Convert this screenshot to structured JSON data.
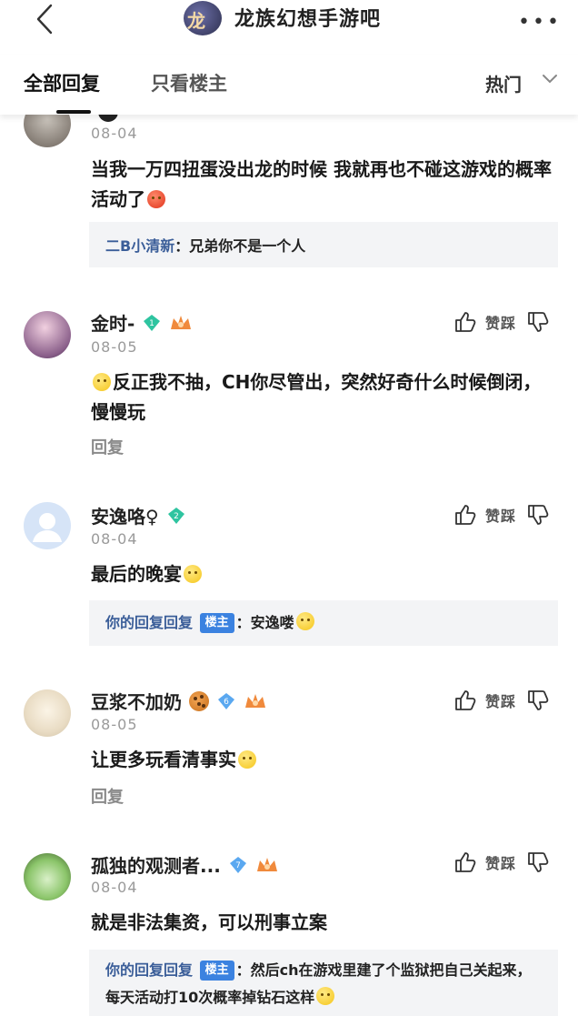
{
  "header": {
    "forum_title": "龙族幻想手游吧",
    "forum_avatar_text": "龙族",
    "back_icon": "chevron-left-icon",
    "more_icon": "more-dots-icon"
  },
  "tabs": {
    "all_replies": "全部回复",
    "host_only": "只看楼主",
    "sort_label": "热门"
  },
  "actions": {
    "like_label": "赞",
    "dislike_label": "踩"
  },
  "comments": [
    {
      "username": "",
      "date": "08-04",
      "text": "当我一万四扭蛋没出龙的时候 我就再也不碰这游戏的概率活动了",
      "sub_reply": {
        "who": "二B小清新",
        "text": "兄弟你不是一个人"
      }
    },
    {
      "username": "金时-",
      "date": "08-05",
      "text": "反正我不抽，CH你尽管出，突然好奇什么时候倒闭，慢慢玩",
      "reply_link": "回复",
      "level": "1"
    },
    {
      "username": "安逸咯♀",
      "date": "08-04",
      "text": "最后的晚宴",
      "level": "2",
      "sub_reply": {
        "who": "你的回复回复",
        "host_tag": "楼主",
        "text": "安逸喽"
      }
    },
    {
      "username": "豆浆不加奶",
      "date": "08-05",
      "text": "让更多玩看清事实",
      "reply_link": "回复",
      "level": "6"
    },
    {
      "username": "孤独的观测者...",
      "date": "08-04",
      "text": "就是非法集资，可以刑事立案",
      "level": "7",
      "sub_reply": {
        "who": "你的回复回复",
        "host_tag": "楼主",
        "text": "然后ch在游戏里建了个监狱把自己关起来，每天活动打10次概率掉钻石这样"
      }
    }
  ]
}
